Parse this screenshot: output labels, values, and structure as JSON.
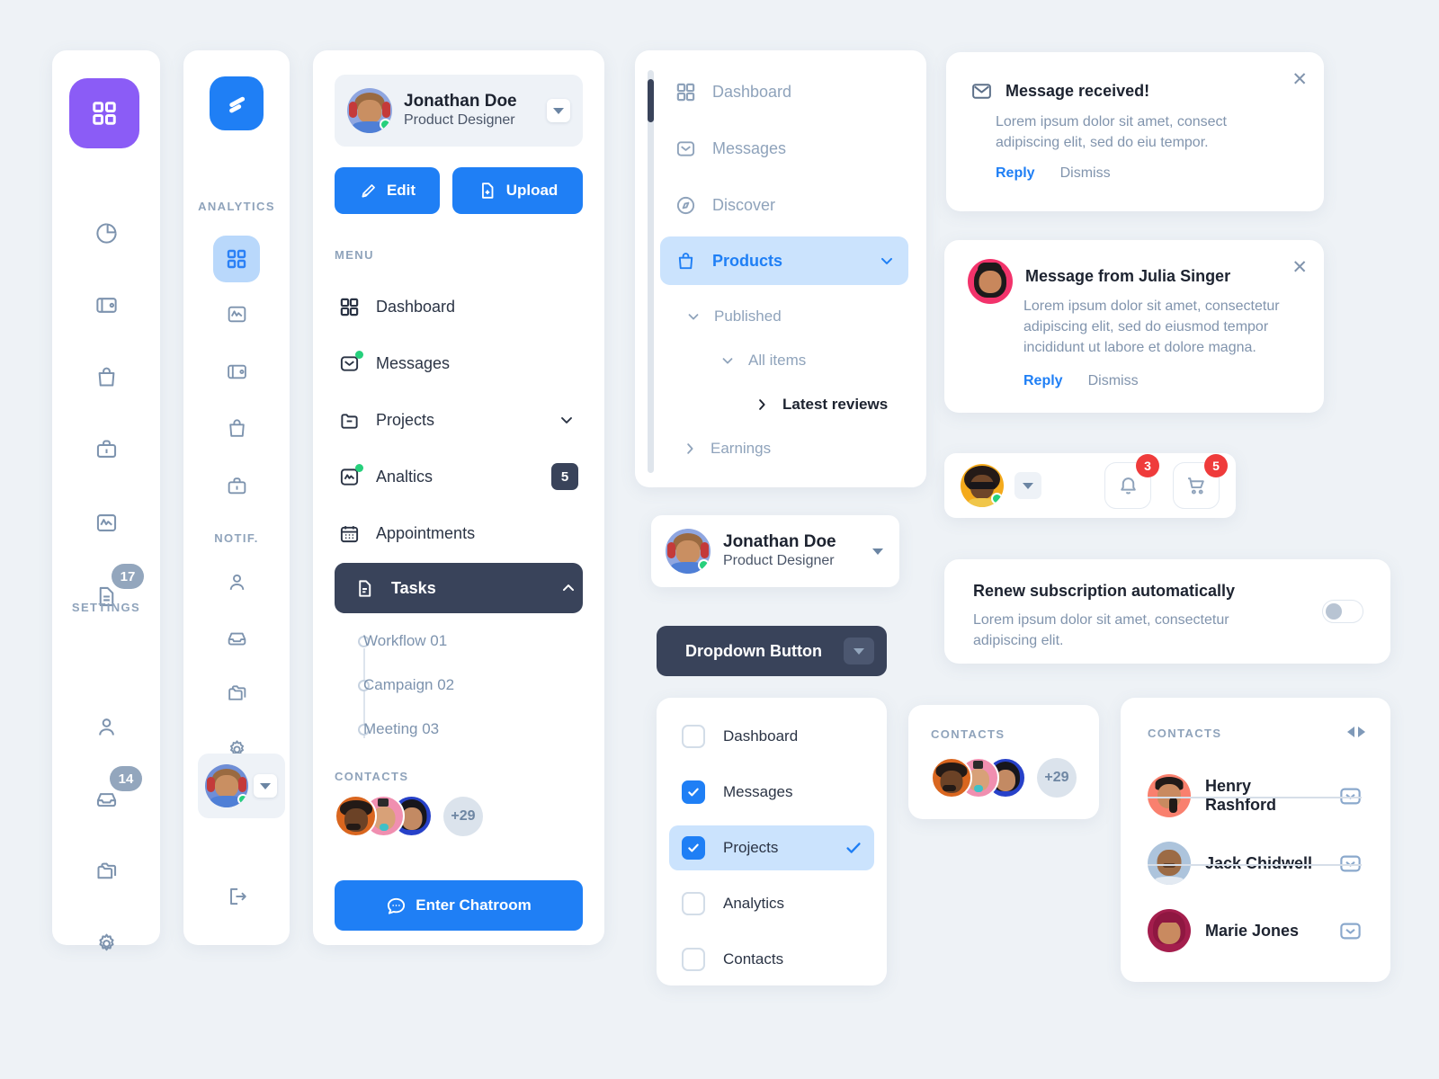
{
  "theme": {
    "background": "#eef2f6",
    "accent_blue": "#1f7ff5",
    "accent_purple": "#8b5cf6",
    "dark": "#39435a",
    "muted_text": "#8fa3bb",
    "badge_red": "#ef3b3b",
    "online_green": "#26d07c",
    "light_blue_selected": "#cbe3fd"
  },
  "icon_rail": {
    "tile_icon": "grid-icon",
    "items": [
      {
        "icon": "pie-chart-icon",
        "badge": null
      },
      {
        "icon": "wallet-icon",
        "badge": null
      },
      {
        "icon": "bag-icon",
        "badge": null
      },
      {
        "icon": "briefcase-icon",
        "badge": null
      },
      {
        "icon": "activity-icon",
        "badge": null
      },
      {
        "icon": "document-icon",
        "badge": "17"
      }
    ],
    "section_label": "SETTINGS",
    "settings_items": [
      {
        "icon": "user-icon",
        "badge": null
      },
      {
        "icon": "inbox-icon",
        "badge": "14"
      },
      {
        "icon": "folders-icon",
        "badge": null
      },
      {
        "icon": "gear-icon",
        "badge": null
      }
    ]
  },
  "analytics_rail": {
    "logo_icon": "app-logo-icon",
    "title": "ANALYTICS",
    "active_icon": "grid-icon",
    "items": [
      {
        "icon": "activity-icon"
      },
      {
        "icon": "wallet-icon"
      },
      {
        "icon": "bag-icon"
      },
      {
        "icon": "briefcase-icon"
      }
    ],
    "section_label": "NOTIF.",
    "notif_items": [
      {
        "icon": "user-icon"
      },
      {
        "icon": "inbox-icon"
      },
      {
        "icon": "folders-icon"
      },
      {
        "icon": "gear-icon"
      }
    ],
    "logout_icon": "logout-icon"
  },
  "menu_panel": {
    "profile": {
      "name": "Jonathan Doe",
      "role": "Product Designer",
      "avatar": "avatar-jonathan",
      "status": "online",
      "caret": "chevron-down-icon"
    },
    "edit_button": {
      "label": "Edit",
      "icon": "pencil-icon"
    },
    "upload_button": {
      "label": "Upload",
      "icon": "file-plus-icon"
    },
    "section_label": "MENU",
    "items": [
      {
        "label": "Dashboard",
        "icon": "grid-icon",
        "badge": null,
        "dot": false,
        "chevron": null,
        "selected": false
      },
      {
        "label": "Messages",
        "icon": "envelope-check-icon",
        "badge": null,
        "dot": true,
        "chevron": null,
        "selected": false
      },
      {
        "label": "Projects",
        "icon": "folder-minus-icon",
        "badge": null,
        "dot": false,
        "chevron": "chevron-down-icon",
        "selected": false
      },
      {
        "label": "Analtics",
        "icon": "chart-square-icon",
        "badge": "5",
        "dot": true,
        "chevron": null,
        "selected": false
      },
      {
        "label": "Appointments",
        "icon": "calendar-icon",
        "badge": null,
        "dot": false,
        "chevron": null,
        "selected": false
      },
      {
        "label": "Tasks",
        "icon": "document-icon",
        "badge": null,
        "dot": false,
        "chevron": "chevron-up-icon",
        "selected": true
      }
    ],
    "subitems": [
      "Workflow 01",
      "Campaign 02",
      "Meeting 03"
    ],
    "contacts_label": "CONTACTS",
    "contacts_more": "+29",
    "chat_button": {
      "label": "Enter Chatroom",
      "icon": "chat-icon"
    }
  },
  "tree_panel": {
    "items": [
      {
        "label": "Dashboard",
        "icon": "grid-icon",
        "selected": false
      },
      {
        "label": "Messages",
        "icon": "envelope-icon",
        "selected": false
      },
      {
        "label": "Discover",
        "icon": "compass-icon",
        "selected": false
      },
      {
        "label": "Products",
        "icon": "bag-icon",
        "selected": true,
        "chevron": "chevron-down-icon"
      }
    ],
    "sub_items": [
      {
        "label": "Published",
        "chevron": "chevron-down-icon",
        "depth": 1,
        "bold": false
      },
      {
        "label": "All items",
        "chevron": "chevron-down-icon",
        "depth": 2,
        "bold": false
      },
      {
        "label": "Latest reviews",
        "chevron": "chevron-right-icon",
        "depth": 3,
        "bold": true
      },
      {
        "label": "Earnings",
        "chevron": "chevron-right-icon",
        "depth": 1,
        "bold": false
      }
    ]
  },
  "profile_card": {
    "name": "Jonathan Doe",
    "role": "Product Designer",
    "caret": "caret-down-icon"
  },
  "dropdown_button": {
    "label": "Dropdown Button",
    "caret": "caret-down-icon"
  },
  "checkbox_list": [
    {
      "label": "Dashboard",
      "checked": false,
      "selected": false
    },
    {
      "label": "Messages",
      "checked": true,
      "selected": false
    },
    {
      "label": "Projects",
      "checked": true,
      "selected": true,
      "check_mark": "check-icon"
    },
    {
      "label": "Analytics",
      "checked": false,
      "selected": false
    },
    {
      "label": "Contacts",
      "checked": false,
      "selected": false
    }
  ],
  "notifications": [
    {
      "icon": "envelope-icon",
      "title": "Message received!",
      "body": "Lorem ipsum dolor sit amet, consect adipiscing elit, sed do eiu tempor.",
      "reply": "Reply",
      "dismiss": "Dismiss",
      "close": "close-icon"
    },
    {
      "avatar": "avatar-julia",
      "title": "Message from Julia Singer",
      "body": "Lorem ipsum dolor sit amet, consectetur adipiscing elit, sed do eiusmod tempor incididunt ut labore et dolore magna.",
      "reply": "Reply",
      "dismiss": "Dismiss",
      "close": "close-icon"
    }
  ],
  "toolbar": {
    "avatar": "avatar-woman-sunglasses",
    "status": "online",
    "caret": "caret-down-icon",
    "bell": {
      "icon": "bell-icon",
      "badge": "3"
    },
    "cart": {
      "icon": "cart-icon",
      "badge": "5"
    }
  },
  "toggle_card": {
    "title": "Renew subscription automatically",
    "subtitle": "Lorem ipsum dolor sit amet, consectetur adipiscing elit.",
    "enabled": false
  },
  "contacts_mini": {
    "label": "CONTACTS",
    "more": "+29"
  },
  "contacts_list": {
    "label": "CONTACTS",
    "nav_prev": "caret-left-icon",
    "nav_next": "caret-right-icon",
    "rows": [
      {
        "name": "Henry Rashford",
        "avatar": "avatar-henry",
        "action": "envelope-icon"
      },
      {
        "name": "Jack Chidwell",
        "avatar": "avatar-jack",
        "action": "envelope-icon"
      },
      {
        "name": "Marie Jones",
        "avatar": "avatar-marie",
        "action": "envelope-icon"
      }
    ]
  }
}
